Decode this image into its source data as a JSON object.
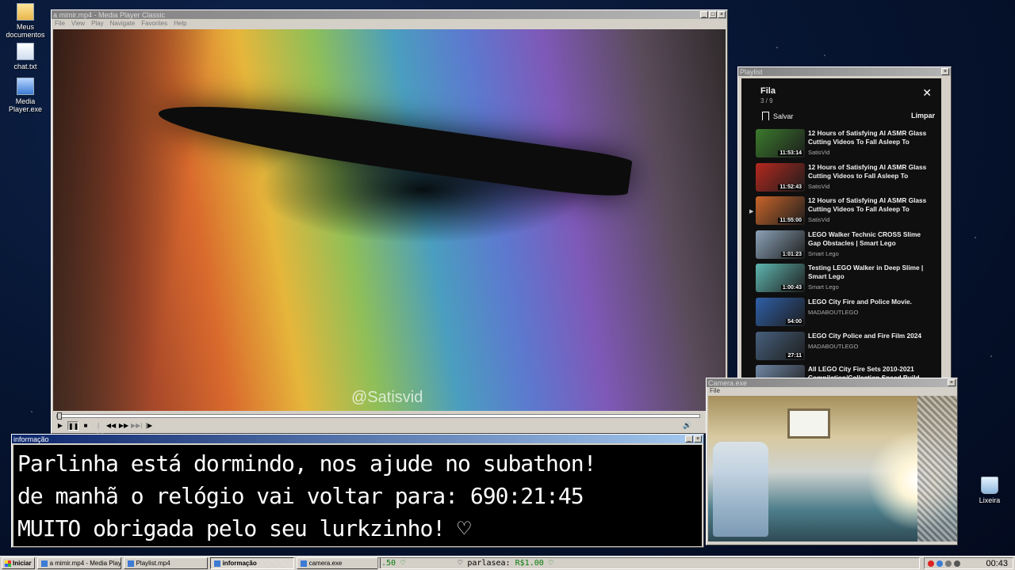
{
  "desktop": {
    "icons": [
      {
        "label": "Meus documentos",
        "icon": "folder-icon"
      },
      {
        "label": "chat.txt",
        "icon": "text-file-icon"
      },
      {
        "label": "Media Player.exe",
        "icon": "exe-icon"
      },
      {
        "label": "Lixeira",
        "icon": "recycle-bin-icon"
      }
    ]
  },
  "mpc": {
    "title": "a mimir.mp4 - Media Player Classic",
    "menu": [
      "File",
      "View",
      "Play",
      "Navigate",
      "Favorites",
      "Help"
    ],
    "watermark": "@Satisvid",
    "progress": 0.0
  },
  "playlist": {
    "window_title": "Playlist",
    "title": "Fila",
    "count": "3 / 9",
    "save_label": "Salvar",
    "clear_label": "Limpar",
    "items": [
      {
        "title": "12 Hours of Satisfying AI ASMR Glass Cutting Videos To Fall Asleep To",
        "channel": "SatisVid",
        "duration": "11:53:14",
        "color": "#3b7a2c"
      },
      {
        "title": "12 Hours of Satisfying AI ASMR Glass Cutting Videos to Fall Asleep To",
        "channel": "SatisVid",
        "duration": "11:52:43",
        "color": "#b5281e"
      },
      {
        "title": "12 Hours of Satisfying AI ASMR Glass Cutting Videos To Fall Asleep To",
        "channel": "SatisVid",
        "duration": "11:55:00",
        "color": "#c9652a",
        "playing": true
      },
      {
        "title": "LEGO Walker Technic CROSS Slime Gap Obstacles | Smart Lego",
        "channel": "Smart Lego",
        "duration": "1:01:23",
        "color": "#8ca3b8"
      },
      {
        "title": "Testing LEGO Walker in Deep Slime | Smart Lego",
        "channel": "Smart Lego",
        "duration": "1:00:43",
        "color": "#5fb7b0"
      },
      {
        "title": "LEGO City Fire and Police Movie.",
        "channel": "MADABOUTLEGO",
        "duration": "54:00",
        "color": "#2f5fa8"
      },
      {
        "title": "LEGO City Police and Fire Film 2024",
        "channel": "MADABOUTLEGO",
        "duration": "27:11",
        "color": "#46607d"
      },
      {
        "title": "All LEGO City Fire Sets 2010-2021 Compilation/Collection Speed Build",
        "channel": "",
        "duration": "",
        "color": "#6f87a5"
      }
    ]
  },
  "info": {
    "title": "informação",
    "lines": [
      "Parlinha está dormindo, nos ajude no subathon!",
      "de manhã o relógio vai voltar para:  690:21:45",
      "MUITO obrigada pelo seu lurkzinho! ♡"
    ]
  },
  "camera": {
    "title": "Camera.exe",
    "menu": "File"
  },
  "taskbar": {
    "start": "Iniciar",
    "tasks": [
      "a mimir.mp4 - Media Playe...",
      "Playlist.mp4",
      "informação",
      "camera.exe"
    ],
    "ticker_prefix": ".50 ♡",
    "ticker_name": "♡ parlasea:",
    "ticker_amount": "R$1.00 ♡",
    "clock": "00:43"
  }
}
